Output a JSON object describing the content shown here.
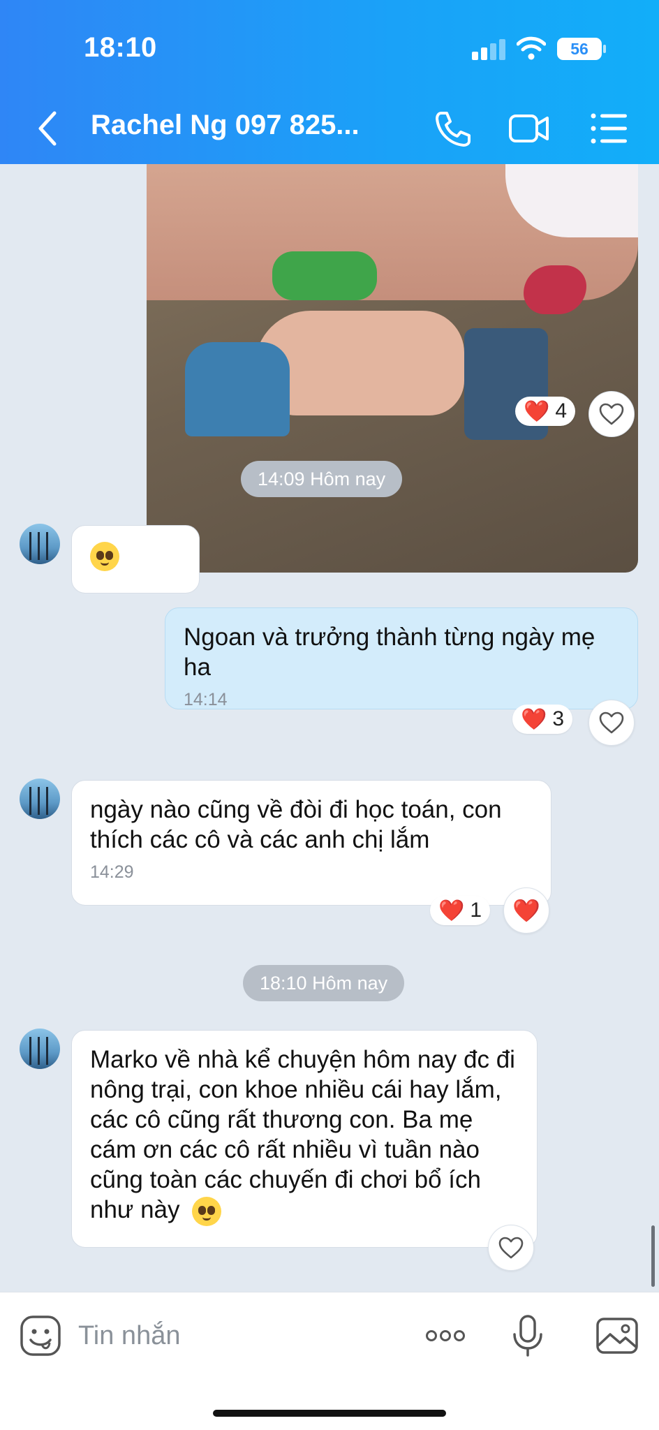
{
  "status_bar": {
    "time": "18:10",
    "battery": "56"
  },
  "header": {
    "title": "Rachel Ng 097 825...",
    "accent": "#2f86f6"
  },
  "icons": {
    "back": "chevron-left-icon",
    "call": "phone-icon",
    "video": "video-camera-icon",
    "menu": "list-menu-icon",
    "sticker": "smiley-sticker-icon",
    "more": "more-dots-icon",
    "mic": "microphone-icon",
    "gallery": "image-gallery-icon"
  },
  "chat": {
    "photo": {
      "reaction_count": "4"
    },
    "separators": [
      {
        "label": "14:09 Hôm nay"
      },
      {
        "label": "18:10 Hôm nay"
      }
    ],
    "messages": [
      {
        "sender": "other",
        "text": ""
      },
      {
        "sender": "me",
        "text": "Ngoan và trưởng thành từng ngày mẹ ha",
        "time": "14:14",
        "reaction_count": "3"
      },
      {
        "sender": "other",
        "text": "ngày nào cũng về đòi đi học toán, con thích các cô và các anh chị lắm",
        "time": "14:29",
        "reaction_count": "1"
      },
      {
        "sender": "other",
        "text": "Marko về nhà kể chuyện hôm nay đc đi nông trại, con khoe nhiều cái hay lắm, các cô cũng rất thương con. Ba mẹ cám ơn các cô rất nhiều vì tuần nào cũng toàn các chuyến đi chơi bổ ích như này"
      }
    ]
  },
  "input": {
    "placeholder": "Tin nhắn"
  }
}
